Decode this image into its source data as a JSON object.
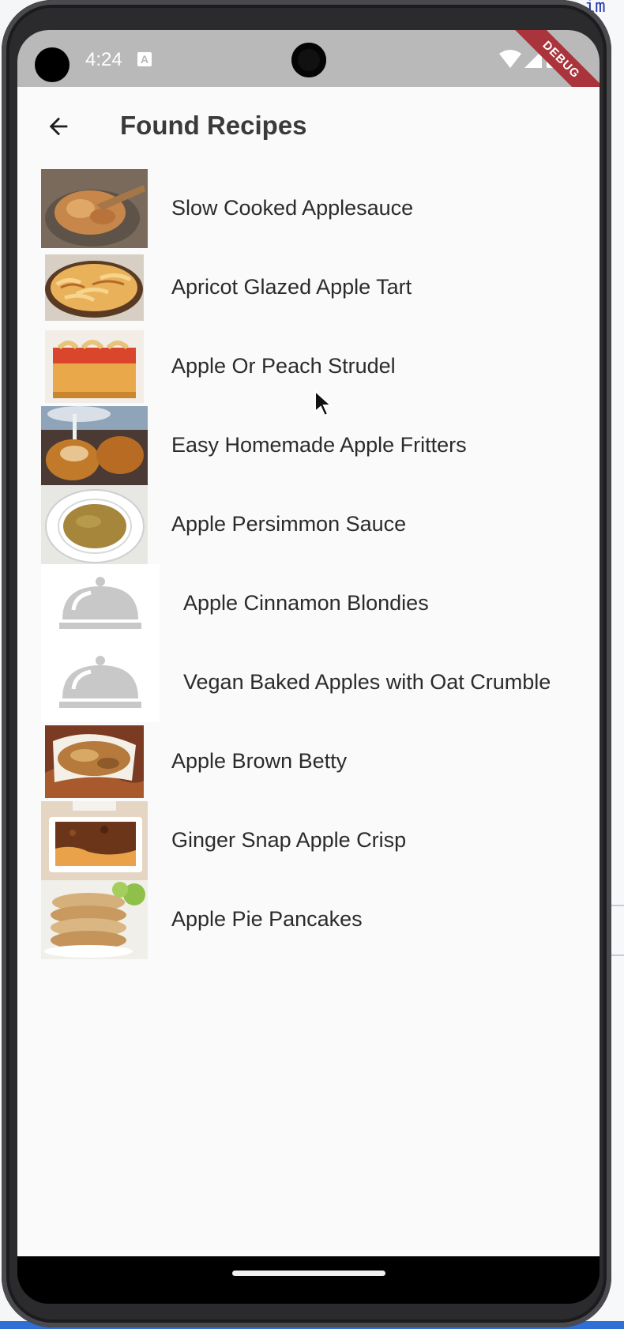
{
  "ide": {
    "code_snippet": "im"
  },
  "status_bar": {
    "time": "4:24",
    "debug_banner": "DEBUG"
  },
  "app_bar": {
    "title": "Found Recipes",
    "back_icon": "arrow-back-icon"
  },
  "recipes": [
    {
      "title": "Slow Cooked Applesauce",
      "image": "photo"
    },
    {
      "title": "Apricot Glazed Apple Tart",
      "image": "photo"
    },
    {
      "title": "Apple Or Peach Strudel",
      "image": "photo"
    },
    {
      "title": "Easy Homemade Apple Fritters",
      "image": "photo"
    },
    {
      "title": "Apple Persimmon Sauce",
      "image": "photo"
    },
    {
      "title": "Apple Cinnamon Blondies",
      "image": "placeholder-cloche"
    },
    {
      "title": "Vegan Baked Apples with Oat Crumble",
      "image": "placeholder-cloche"
    },
    {
      "title": "Apple Brown Betty",
      "image": "photo"
    },
    {
      "title": "Ginger Snap Apple Crisp",
      "image": "photo"
    },
    {
      "title": "Apple Pie Pancakes",
      "image": "photo"
    }
  ],
  "colors": {
    "status_bar": "#b9b9b9",
    "debug_ribbon": "#a9343b",
    "app_background": "#fafafa",
    "placeholder_icon": "#c8c8c8"
  }
}
